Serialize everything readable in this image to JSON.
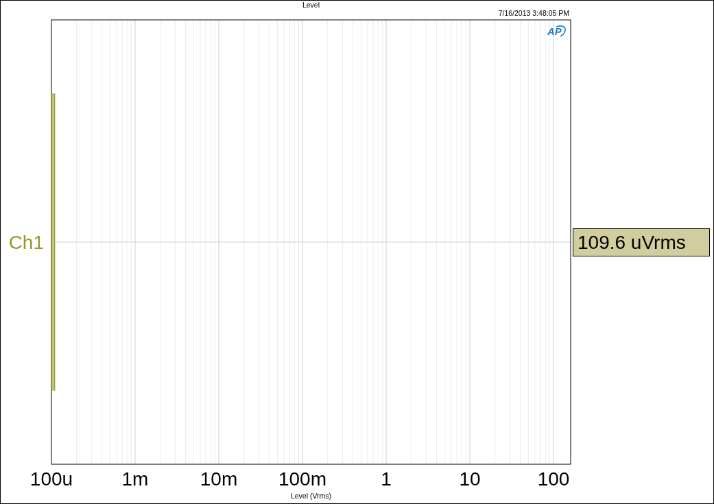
{
  "chart": {
    "title": "Level",
    "timestamp": "7/16/2013 3:48:05 PM",
    "logo": "AP",
    "channels": [
      {
        "name": "Ch1",
        "color": "#99972c",
        "level": 0.0064,
        "reading": "109.6 uVrms"
      }
    ],
    "scale_labels": [
      "100u",
      "1m",
      "10m",
      "100m",
      "1",
      "10",
      "100"
    ],
    "axis_title": "Level (Vrms)"
  }
}
